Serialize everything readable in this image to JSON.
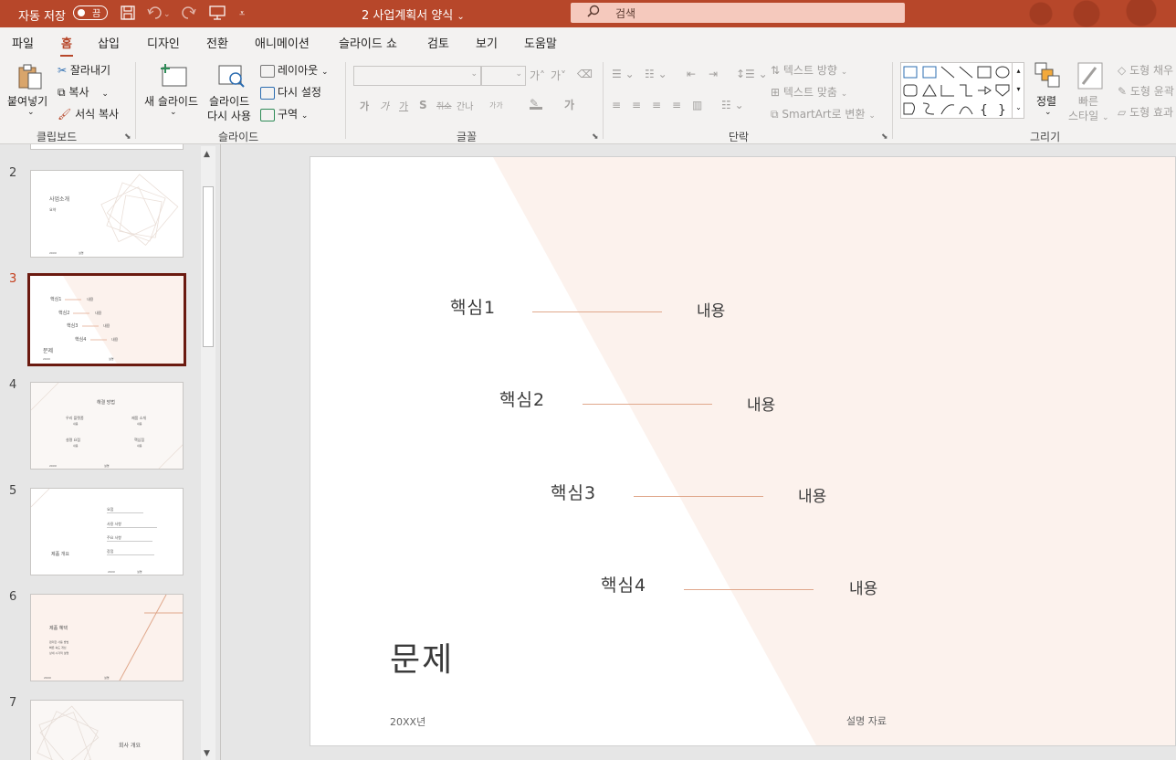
{
  "titlebar": {
    "autosave_label": "자동 저장",
    "autosave_state": "끔",
    "doc_title": "2 사업계획서 양식",
    "doc_title_caret": "⌄",
    "search_placeholder": "검색",
    "icons": [
      "save-icon",
      "undo-icon",
      "redo-icon",
      "present-icon",
      "customize-icon",
      "search-icon"
    ]
  },
  "menu": {
    "tabs": [
      "파일",
      "홈",
      "삽입",
      "디자인",
      "전환",
      "애니메이션",
      "슬라이드 쇼",
      "검토",
      "보기",
      "도움말"
    ],
    "active_tab": "홈"
  },
  "ribbon": {
    "clipboard": {
      "paste": "붙여넣기",
      "cut": "잘라내기",
      "copy": "복사",
      "format_painter": "서식 복사",
      "group_label": "클립보드"
    },
    "slides": {
      "new_slide": "새 슬라이드",
      "reuse_slide_1": "슬라이드",
      "reuse_slide_2": "다시 사용",
      "layout": "레이아웃",
      "reset": "다시 설정",
      "section": "구역",
      "group_label": "슬라이드"
    },
    "font": {
      "group_label": "글꼴",
      "grow": "가˄",
      "shrink": "가˅",
      "bold": "가",
      "italic": "가",
      "underline": "가",
      "strike": "S",
      "strikethrough": "취소",
      "spacing": "간나",
      "case": "가가",
      "font_color": "가"
    },
    "paragraph": {
      "group_label": "단락",
      "text_direction": "텍스트 방향",
      "align_text": "텍스트 맞춤",
      "smartart": "SmartArt로 변환"
    },
    "drawing": {
      "group_label": "그리기",
      "arrange": "정렬",
      "quick_styles_1": "빠른",
      "quick_styles_2": "스타일",
      "shape_fill": "도형 채우",
      "shape_outline": "도형 윤곽",
      "shape_effects": "도형 효과"
    }
  },
  "thumbnails": [
    {
      "num": "2",
      "title": "사업소개",
      "sub": "요약",
      "foot_left": "20XX",
      "foot_mid": "설명"
    },
    {
      "num": "3",
      "keys": [
        "핵심1",
        "핵심2",
        "핵심3",
        "핵심4"
      ],
      "val": "내용",
      "title": "문제",
      "foot_left": "20XX",
      "foot_mid": "설명"
    },
    {
      "num": "4",
      "title": "해결 방법",
      "items": [
        "우리 플랫폼",
        "제품 소개",
        "설명 요점",
        "핵심점"
      ],
      "sub": "내용",
      "foot_left": "20XX",
      "foot_mid": "설명"
    },
    {
      "num": "5",
      "title": "제품 개요",
      "heads": [
        "요점",
        "사용 사항",
        "주요 사항",
        "장점"
      ],
      "foot_left": "20XX",
      "foot_mid": "설명"
    },
    {
      "num": "6",
      "title": "제품 혜택",
      "lines": [
        "편리한 사용 방법",
        "빠른 속도 개선",
        "상세 시각적 설명"
      ],
      "foot_left": "20XX",
      "foot_mid": "설명"
    },
    {
      "num": "7",
      "title": "회사 개요"
    }
  ],
  "slide": {
    "keys": [
      "핵심1",
      "핵심2",
      "핵심3",
      "핵심4"
    ],
    "values": [
      "내용",
      "내용",
      "내용",
      "내용"
    ],
    "title": "문제",
    "footer_left": "20XX년",
    "footer_right": "설명 자료"
  },
  "colors": {
    "accent": "#b7472a",
    "slide_tint": "#fcf2ed",
    "key_line": "#e0a88c",
    "selected_border": "#6b1a10"
  }
}
